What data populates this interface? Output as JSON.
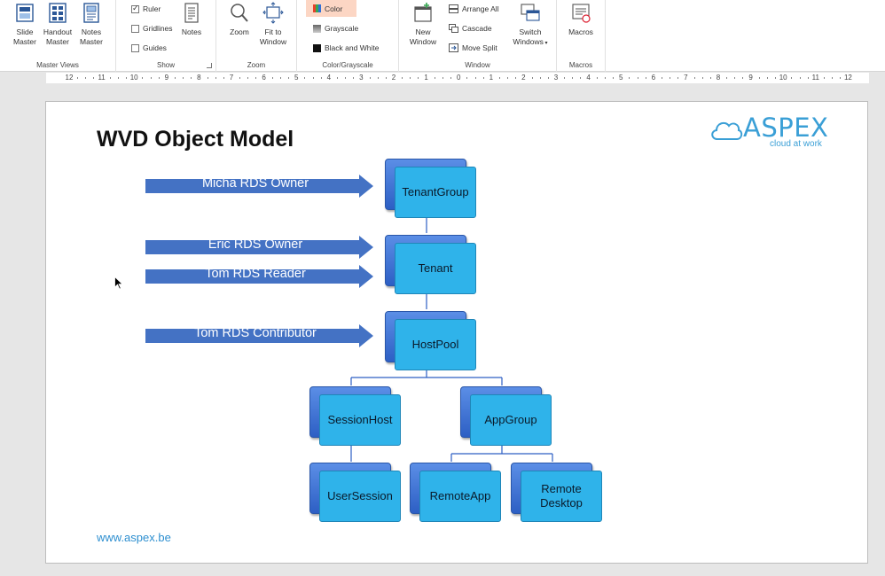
{
  "ribbon": {
    "master_views": {
      "label": "Master Views",
      "buttons": [
        {
          "label": "Slide\nMaster",
          "l1": "Slide",
          "l2": "Master"
        },
        {
          "label": "Handout Master",
          "l1": "Handout",
          "l2": "Master"
        },
        {
          "label": "Notes Master",
          "l1": "Notes",
          "l2": "Master"
        }
      ]
    },
    "show": {
      "label": "Show",
      "ruler": {
        "label": "Ruler",
        "checked": true
      },
      "gridlines": {
        "label": "Gridlines",
        "checked": false
      },
      "guides": {
        "label": "Guides",
        "checked": false
      },
      "notes_label": "Notes"
    },
    "zoom": {
      "label": "Zoom",
      "zoom_label": "Zoom",
      "fit_l1": "Fit to",
      "fit_l2": "Window"
    },
    "color": {
      "label": "Color/Grayscale",
      "color_label": "Color",
      "grayscale_label": "Grayscale",
      "bw_label": "Black and White"
    },
    "window": {
      "label": "Window",
      "new_l1": "New",
      "new_l2": "Window",
      "arrange_all": "Arrange All",
      "cascade": "Cascade",
      "move_split": "Move Split",
      "switch_l1": "Switch",
      "switch_l2": "Windows"
    },
    "macros": {
      "label": "Macros",
      "button": "Macros"
    }
  },
  "ruler": {
    "ticks": [
      "12",
      "11",
      "10",
      "9",
      "8",
      "7",
      "6",
      "5",
      "4",
      "3",
      "2",
      "1",
      "0",
      "1",
      "2",
      "3",
      "4",
      "5",
      "6",
      "7",
      "8",
      "9",
      "10",
      "11",
      "12"
    ]
  },
  "slide": {
    "title": "WVD Object Model",
    "logo_text": "ASPEX",
    "logo_tagline": "cloud at work",
    "footer_url": "www.aspex.be",
    "arrows": [
      {
        "label": "Micha RDS Owner",
        "target": "TenantGroup"
      },
      {
        "label": "Eric RDS Owner",
        "target": "Tenant"
      },
      {
        "label": "Tom RDS Reader",
        "target": "Tenant"
      },
      {
        "label": "Tom RDS Contributor",
        "target": "HostPool"
      }
    ],
    "nodes": [
      {
        "label": "TenantGroup"
      },
      {
        "label": "Tenant"
      },
      {
        "label": "HostPool"
      },
      {
        "label": "SessionHost"
      },
      {
        "label": "AppGroup"
      },
      {
        "label": "UserSession"
      },
      {
        "label": "RemoteApp"
      },
      {
        "label": "Remote\nDesktop"
      }
    ]
  },
  "colors": {
    "arrow": "#4472c4",
    "node_front": "#2fb3ea",
    "node_back": "#3c6fd3",
    "brand": "#3a9fd6",
    "color_button_highlight": "#fcd6c4"
  }
}
